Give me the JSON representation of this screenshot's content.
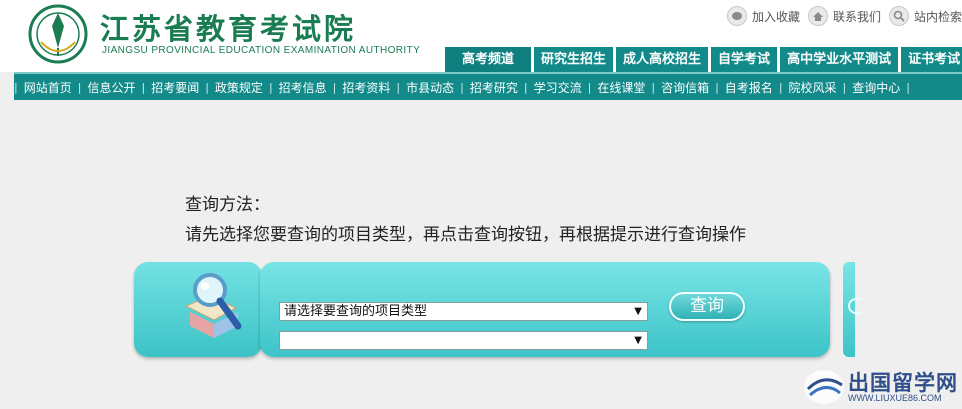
{
  "header": {
    "title": "江苏省教育考试院",
    "subtitle": "JIANGSU PROVINCIAL EDUCATION EXAMINATION AUTHORITY",
    "top_links": [
      {
        "label": "加入收藏",
        "icon": "bookmark-icon"
      },
      {
        "label": "联系我们",
        "icon": "home-icon"
      },
      {
        "label": "站内检索",
        "icon": "search-icon"
      }
    ],
    "tabs": [
      {
        "label": "高考频道"
      },
      {
        "label": "研究生招生"
      },
      {
        "label": "成人高校招生"
      },
      {
        "label": "自学考试"
      },
      {
        "label": "高中学业水平测试"
      },
      {
        "label": "证书考试"
      }
    ]
  },
  "nav": {
    "items": [
      "网站首页",
      "信息公开",
      "招考要闻",
      "政策规定",
      "招考信息",
      "招考资料",
      "市县动态",
      "招考研究",
      "学习交流",
      "在线课堂",
      "咨询信箱",
      "自考报名",
      "院校风采",
      "查询中心"
    ]
  },
  "instructions": {
    "line1": "查询方法：",
    "line2": "请先选择您要查询的项目类型，再点击查询按钮，再根据提示进行查询操作"
  },
  "query": {
    "type_select_value": "请选择要查询的项目类型",
    "sub_select_value": "",
    "button_label": "查询"
  },
  "watermark": {
    "title": "出国留学网",
    "url": "WWW.LIUXUE86.COM"
  },
  "colors": {
    "brand_green": "#1a7d52",
    "teal": "#138a8a",
    "panel": "#3cc4c7"
  }
}
